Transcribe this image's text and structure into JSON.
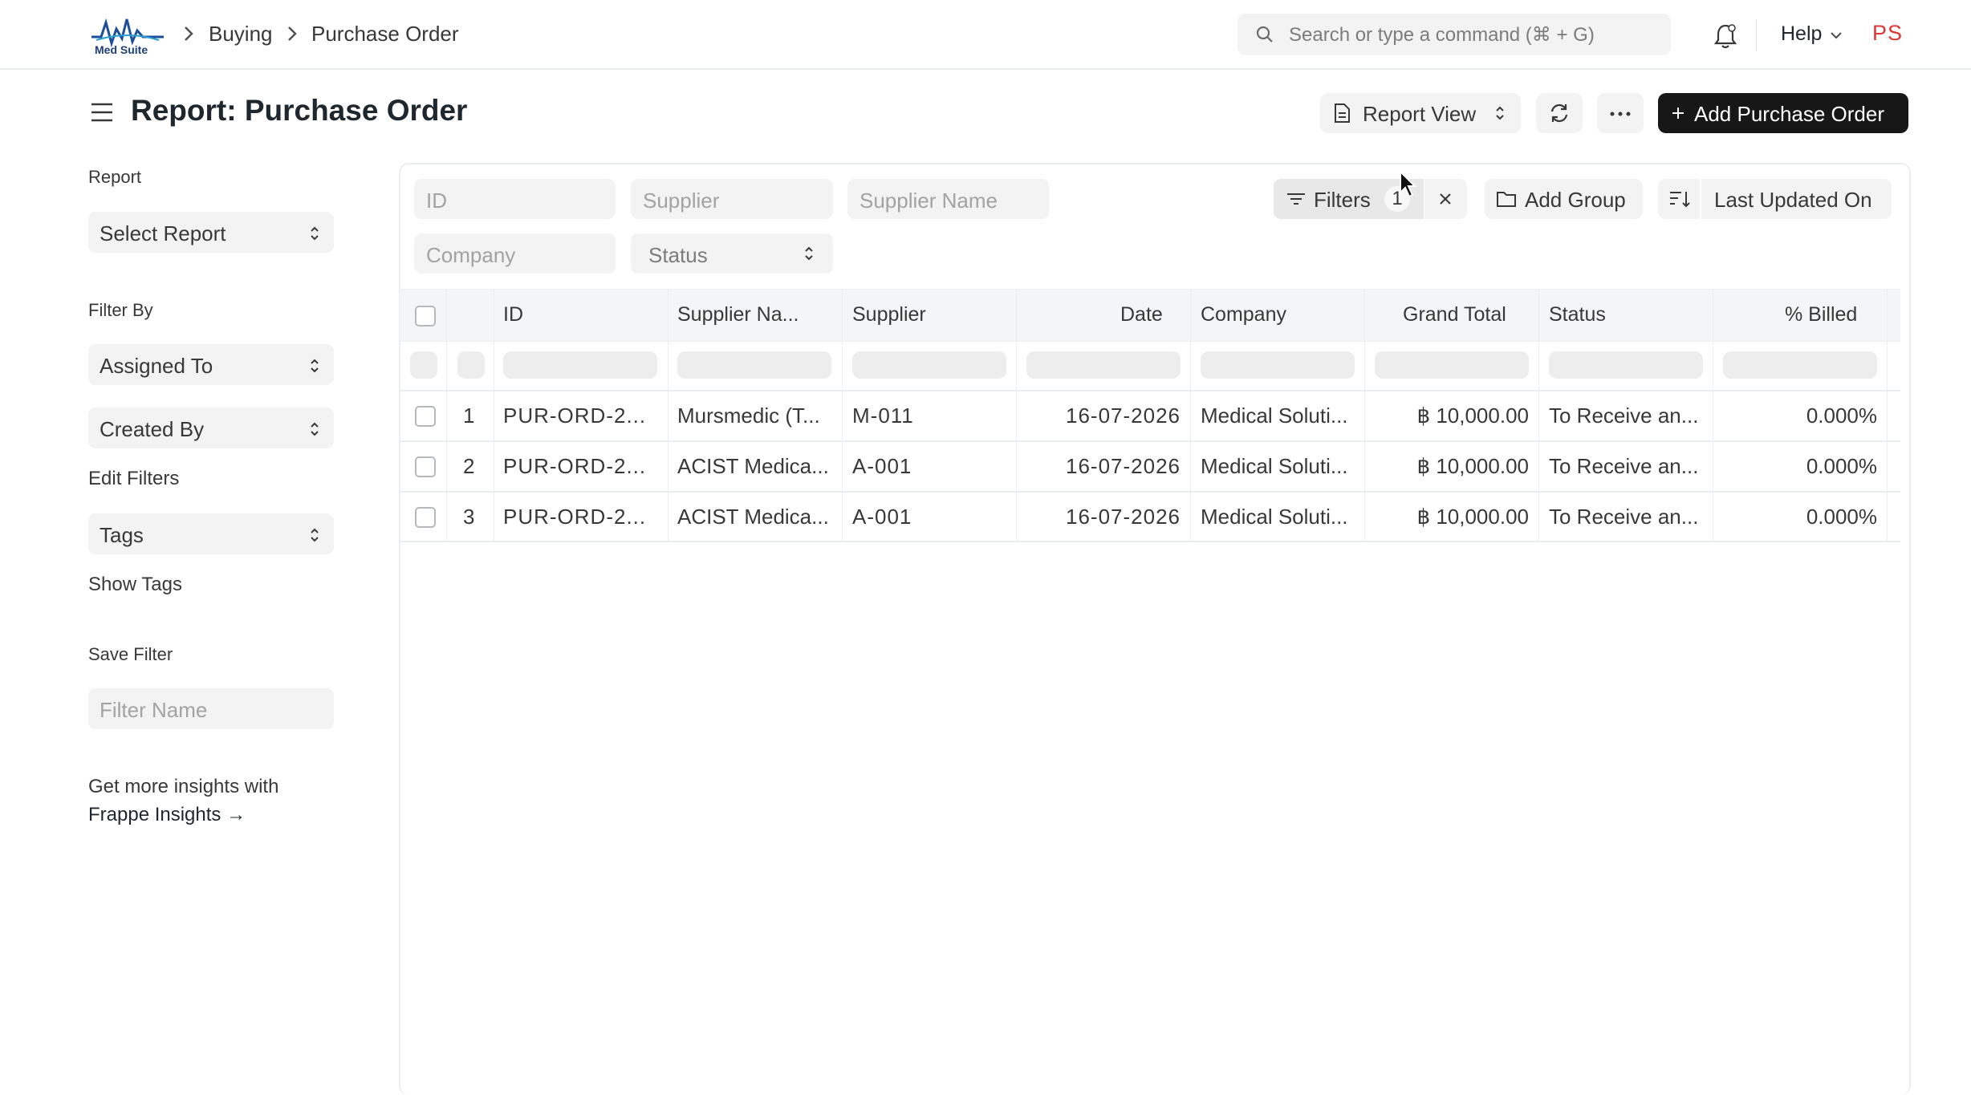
{
  "navbar": {
    "logo_text": "Med Suite",
    "breadcrumbs": [
      "Buying",
      "Purchase Order"
    ],
    "search_placeholder": "Search or type a command (⌘ + G)",
    "help_label": "Help",
    "avatar_initials": "PS"
  },
  "header": {
    "title": "Report: Purchase Order",
    "view_selector": "Report View",
    "add_button": "Add Purchase Order"
  },
  "sidebar": {
    "report_label": "Report",
    "select_report": "Select Report",
    "filter_by_label": "Filter By",
    "assigned_to": "Assigned To",
    "created_by": "Created By",
    "edit_filters": "Edit Filters",
    "tags": "Tags",
    "show_tags": "Show Tags",
    "save_filter_label": "Save Filter",
    "filter_name_placeholder": "Filter Name",
    "insights_line1": "Get more insights with",
    "insights_line2": "Frappe Insights →"
  },
  "filters": {
    "id_placeholder": "ID",
    "supplier_placeholder": "Supplier",
    "supplier_name_placeholder": "Supplier Name",
    "company_placeholder": "Company",
    "status_placeholder": "Status",
    "filters_label": "Filters",
    "filters_count": "1",
    "add_group": "Add Group",
    "sort_label": "Last Updated On"
  },
  "table": {
    "columns": [
      "ID",
      "Supplier Na...",
      "Supplier",
      "Date",
      "Company",
      "Grand Total",
      "Status",
      "% Billed"
    ],
    "rows": [
      {
        "n": "1",
        "id": "PUR-ORD-2...",
        "supplier_name": "Mursmedic (T...",
        "supplier": "M-011",
        "date": "16-07-2026",
        "company": "Medical Soluti...",
        "grand_total": "฿ 10,000.00",
        "status": "To Receive an...",
        "billed": "0.000%"
      },
      {
        "n": "2",
        "id": "PUR-ORD-2...",
        "supplier_name": "ACIST Medica...",
        "supplier": "A-001",
        "date": "16-07-2026",
        "company": "Medical Soluti...",
        "grand_total": "฿ 10,000.00",
        "status": "To Receive an...",
        "billed": "0.000%"
      },
      {
        "n": "3",
        "id": "PUR-ORD-2...",
        "supplier_name": "ACIST Medica...",
        "supplier": "A-001",
        "date": "16-07-2026",
        "company": "Medical Soluti...",
        "grand_total": "฿ 10,000.00",
        "status": "To Receive an...",
        "billed": "0.000%"
      }
    ]
  }
}
